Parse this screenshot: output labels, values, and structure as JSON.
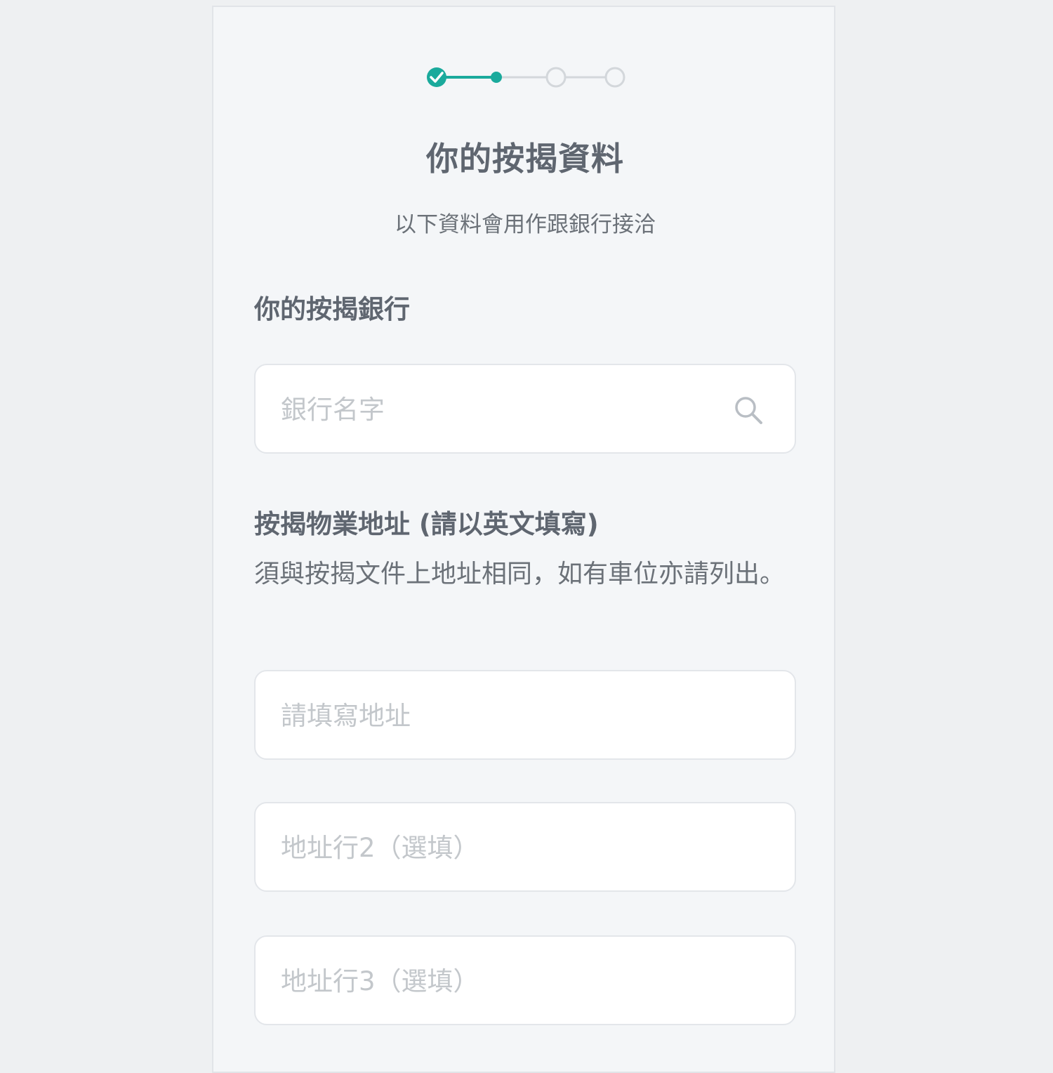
{
  "stepper": {
    "steps": [
      {
        "state": "completed"
      },
      {
        "state": "current"
      },
      {
        "state": "upcoming"
      },
      {
        "state": "upcoming"
      }
    ],
    "accent_color": "#1aaa9c",
    "inactive_color": "#d3d7db"
  },
  "header": {
    "title": "你的按揭資料",
    "subtitle": "以下資料會用作跟銀行接洽"
  },
  "bank_section": {
    "label": "你的按揭銀行",
    "search_placeholder": "銀行名字",
    "search_icon": "search-icon"
  },
  "address_section": {
    "label": "按揭物業地址 (請以英文填寫)",
    "hint": "須與按揭文件上地址相同，如有車位亦請列出。",
    "line1_placeholder": "請填寫地址",
    "line2_placeholder": "地址行2（選填）",
    "line3_placeholder": "地址行3（選填）"
  }
}
